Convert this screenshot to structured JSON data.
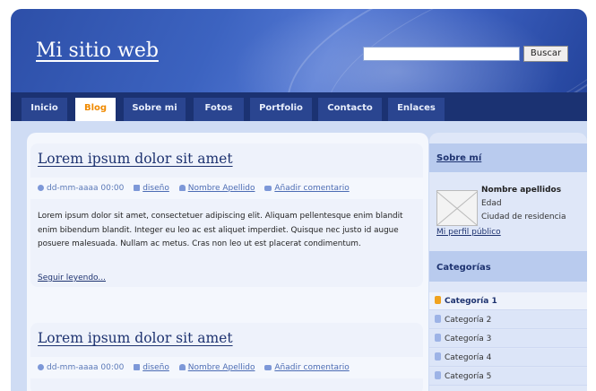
{
  "header": {
    "site_title": "Mi sitio web",
    "search_value": "",
    "search_button": "Buscar"
  },
  "nav": {
    "tabs": [
      {
        "label": "Inicio",
        "active": false
      },
      {
        "label": "Blog",
        "active": true
      },
      {
        "label": "Sobre mi",
        "active": false
      },
      {
        "label": "Fotos",
        "active": false
      },
      {
        "label": "Portfolio",
        "active": false
      },
      {
        "label": "Contacto",
        "active": false
      },
      {
        "label": "Enlaces",
        "active": false
      }
    ]
  },
  "posts": [
    {
      "title": "Lorem ipsum dolor sit amet",
      "date": "dd-mm-aaaa 00:00",
      "category": "diseño",
      "author": "Nombre Apellido",
      "comment": "Añadir comentario",
      "body": "Lorem ipsum dolor sit amet, consectetuer adipiscing elit. Aliquam pellentesque enim blandit enim bibendum blandit. Integer eu leo ac est aliquet imperdiet. Quisque nec justo id augue posuere malesuada. Nullam ac metus. Cras non leo ut est placerat condimentum.",
      "read_more": "Seguir leyendo..."
    },
    {
      "title": "Lorem ipsum dolor sit amet",
      "date": "dd-mm-aaaa 00:00",
      "category": "diseño",
      "author": "Nombre Apellido",
      "comment": "Añadir comentario"
    }
  ],
  "sidebar": {
    "about_title": "Sobre mí",
    "profile": {
      "name": "Nombre apellidos",
      "age": "Edad",
      "city": "Ciudad de residencia",
      "link": "Mi perfil público"
    },
    "categories_title": "Categorías",
    "categories": [
      "Categoría 1",
      "Categoría 2",
      "Categoría 3",
      "Categoría 4",
      "Categoría 5"
    ],
    "active_category": "Categoría 1"
  },
  "icons": {
    "date": "clock-icon",
    "category": "folder-icon",
    "author": "user-icon",
    "comment": "comment-icon",
    "category_bullet": "list-bullet-icon"
  },
  "colors": {
    "header_blue": "#3c63c0",
    "nav_dark": "#1b3272",
    "active_tab_text": "#f08a00",
    "link": "#1e3370"
  }
}
